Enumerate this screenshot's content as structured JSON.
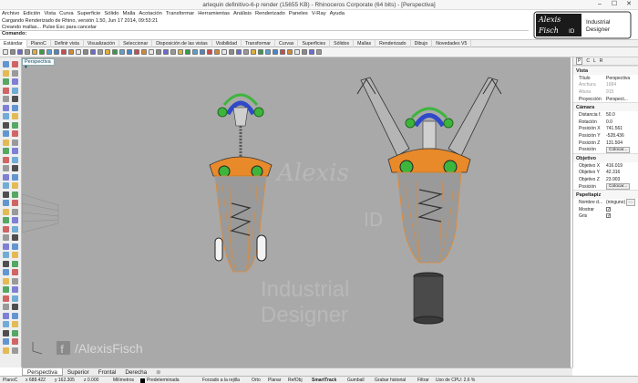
{
  "window": {
    "title": "arlequin definitivo-6-p render (15655 KB) - Rhinoceros Corporate (64 bits) - [Perspectiva]",
    "minimize": "–",
    "maximize": "☐",
    "close": "✕"
  },
  "menu": [
    "Archivo",
    "Edición",
    "Vista",
    "Curva",
    "Superficie",
    "Sólido",
    "Malla",
    "Acotación",
    "Transformar",
    "Herramientas",
    "Análisis",
    "Renderizado",
    "Paneles",
    "V-Ray",
    "Ayuda"
  ],
  "command": {
    "line1": "Cargando Renderizado de Rhino, versión 1.50, Jun 17 2014, 09:53:21",
    "line2": "Creando mallas... Pulse Esc para cancelar",
    "prompt": "Comando:"
  },
  "logo": {
    "name_line1": "Alexis",
    "name_line2": "Fisch",
    "id": "ID",
    "tagline1": "Industrial",
    "tagline2": "Designer"
  },
  "tabs": [
    "Estándar",
    "PlanoC",
    "Definir vista",
    "Visualización",
    "Seleccionar",
    "Disposición de las vistas",
    "Visibilidad",
    "Transformar",
    "Curvas",
    "Superficies",
    "Sólidos",
    "Mallas",
    "Renderizado",
    "Dibujo",
    "Novedades V5"
  ],
  "viewport": {
    "label": "Perspectiva",
    "watermark_handle": "/AlexisFisch",
    "watermark_line1": "Industrial",
    "watermark_line2": "Designer",
    "watermark_name": "Alexis",
    "watermark_id": "ID"
  },
  "panel": {
    "tabs": [
      "P",
      "C",
      "L",
      "R"
    ],
    "sections": {
      "vista": "Vista",
      "camara": "Cámara",
      "objetivo": "Objetivo",
      "papel": "Papeltapiz"
    },
    "vista_rows": [
      {
        "k": "Título",
        "v": "Perspectiva",
        "disabled": false
      },
      {
        "k": "Anchura",
        "v": "1684",
        "disabled": true
      },
      {
        "k": "Altura",
        "v": "915",
        "disabled": true
      },
      {
        "k": "Proyección",
        "v": "Perspect...",
        "disabled": false
      }
    ],
    "camara_rows": [
      {
        "k": "Distancia f.",
        "v": "50.0"
      },
      {
        "k": "Rotación",
        "v": "0.0"
      },
      {
        "k": "Posición X",
        "v": "741.561"
      },
      {
        "k": "Posición Y",
        "v": "-528.436"
      },
      {
        "k": "Posición Z",
        "v": "131.504"
      }
    ],
    "camara_pos_label": "Posición",
    "color_btn": "Colocar...",
    "objetivo_rows": [
      {
        "k": "Objetivo X",
        "v": "416.019"
      },
      {
        "k": "Objetivo Y",
        "v": "42.316"
      },
      {
        "k": "Objetivo Z",
        "v": "23.903"
      }
    ],
    "objetivo_pos_label": "Posición",
    "papel_nombre": "Nombre d...",
    "papel_nombre_val": "(ninguno)",
    "papel_more": "...",
    "mostrar": "Mostrar",
    "gris": "Gris"
  },
  "view_tabs": [
    "Perspectiva",
    "Superior",
    "Frontal",
    "Derecha"
  ],
  "view_tabs_add": "⊕",
  "status": {
    "plane": "PlanoC",
    "x": "x 688.422",
    "y": "y 162.305",
    "z": "z 0.000",
    "units": "Milímetros",
    "layer": "Predeterminada",
    "snap": "Forzado a la rejilla",
    "orto": "Orto",
    "planar": "Planar",
    "refobj": "RefObj",
    "smarttrack": "SmartTrack",
    "gumball": "Gumball",
    "historial": "Grabar historial",
    "filtrar": "Filtrar",
    "cpu": "Uso de CPU: 2.6 %"
  },
  "colors": {
    "viewport_bg": "#a9a9a9",
    "model_orange": "#e8892a",
    "handle_green": "#3db53d",
    "handle_blue": "#2f49c8",
    "accent_blue": "#1f5fbf"
  }
}
